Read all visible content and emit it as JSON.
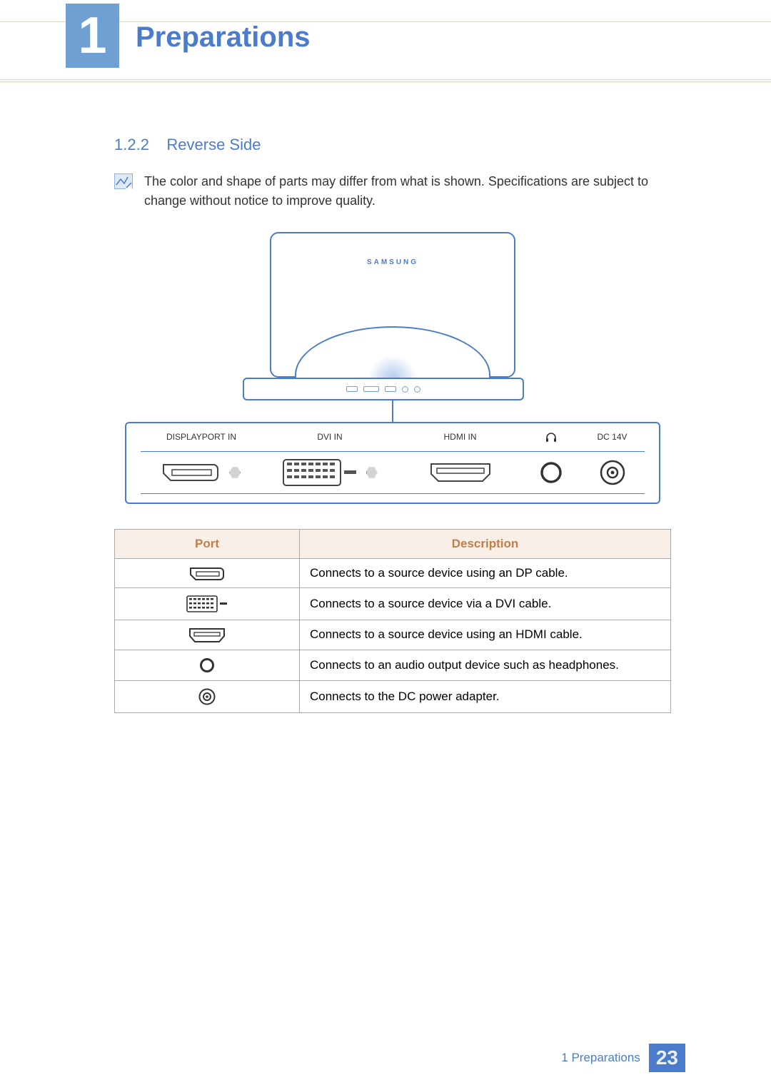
{
  "chapter": {
    "number": "1",
    "title": "Preparations"
  },
  "section": {
    "number": "1.2.2",
    "title": "Reverse Side"
  },
  "note": "The color and shape of parts may differ from what is shown. Specifications are subject to change without notice to improve quality.",
  "diagram": {
    "brand": "SAMSUNG",
    "port_labels": {
      "displayport": "DISPLAYPORT IN",
      "dvi": "DVI IN",
      "hdmi": "HDMI IN",
      "headphone_icon": "headphone",
      "dc": "DC 14V"
    }
  },
  "table": {
    "headers": {
      "port": "Port",
      "description": "Description"
    },
    "rows": [
      {
        "port_icon": "dp",
        "description": "Connects to a source device using an DP cable."
      },
      {
        "port_icon": "dvi",
        "description": "Connects to a source device via a DVI cable."
      },
      {
        "port_icon": "hdmi",
        "description": "Connects to a source device using an HDMI cable."
      },
      {
        "port_icon": "audio",
        "description": "Connects to an audio output device such as headphones."
      },
      {
        "port_icon": "dc",
        "description": "Connects to the DC power adapter."
      }
    ]
  },
  "footer": {
    "label": "1 Preparations",
    "page": "23"
  }
}
